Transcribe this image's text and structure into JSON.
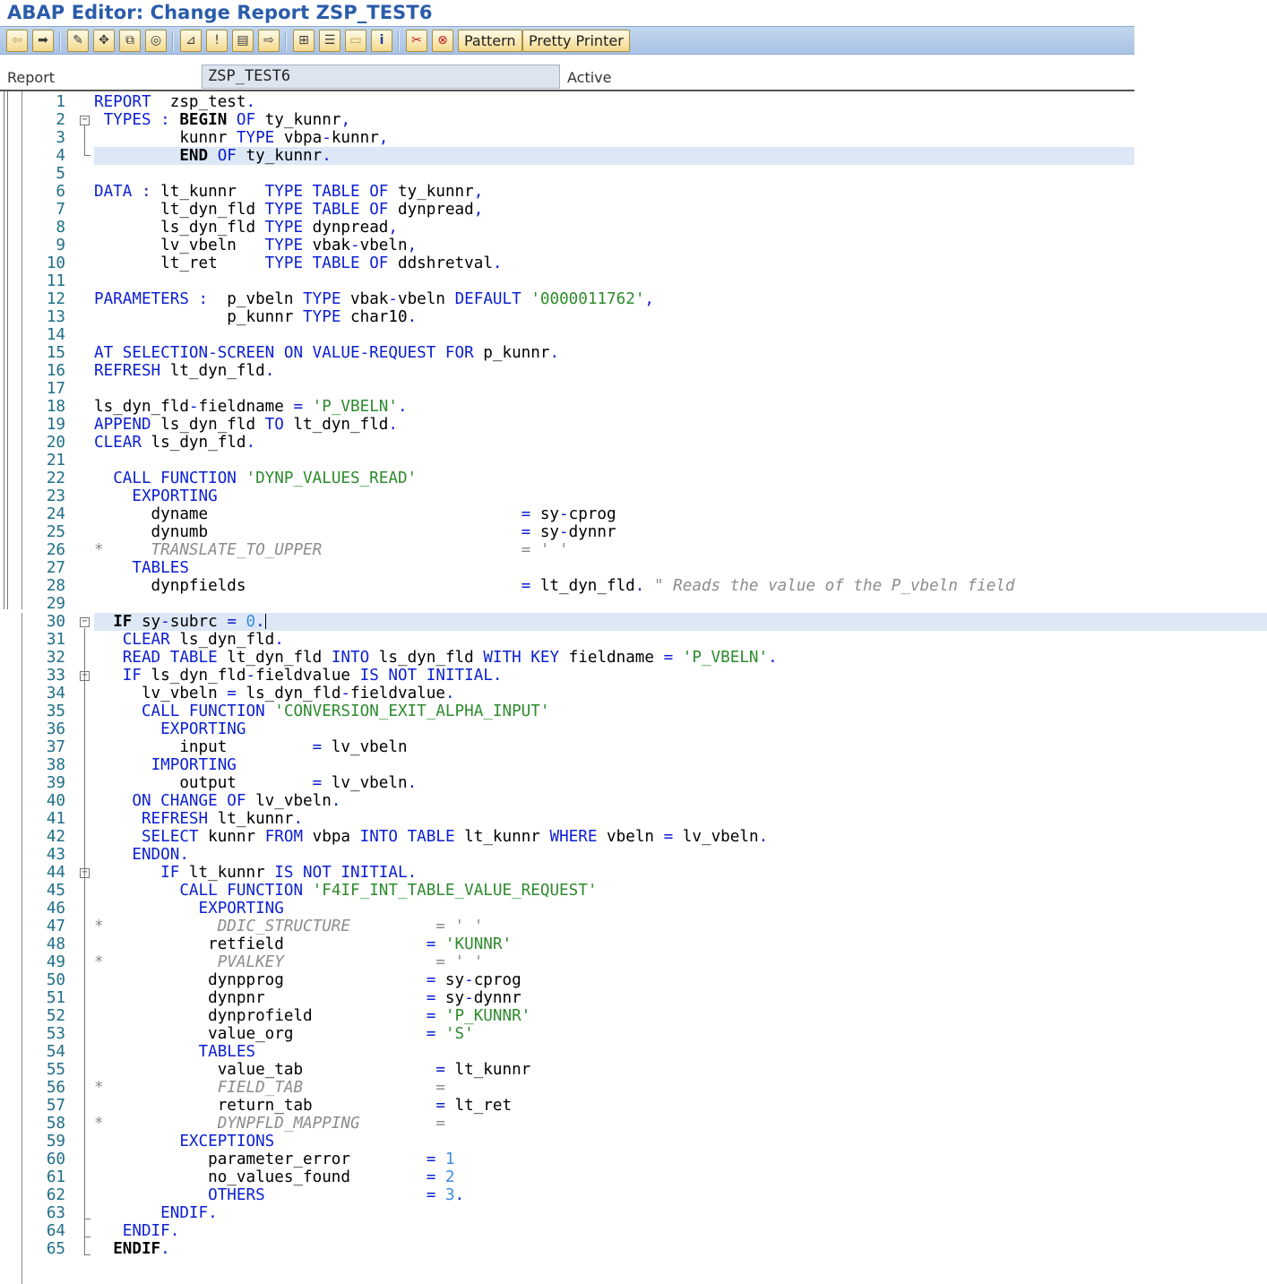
{
  "window": {
    "title": "ABAP Editor: Change Report ZSP_TEST6"
  },
  "toolbar": {
    "icons": [
      "back-icon",
      "forward-icon",
      "check-icon",
      "display-change-icon",
      "activate-icon",
      "test-icon",
      "where-used-icon",
      "set-breakpoint-icon",
      "stack-icon",
      "other-object-icon",
      "object-list-icon",
      "hierarchy-icon",
      "blank-icon",
      "info-icon",
      "cut-icon",
      "copy-icon"
    ],
    "pattern_label": "Pattern",
    "pretty_printer_label": "Pretty Printer"
  },
  "header": {
    "report_label": "Report",
    "report_value": "ZSP_TEST6",
    "status": "Active"
  },
  "editor": {
    "highlighted_lines": [
      4,
      30
    ],
    "cursor_line": 30,
    "lines": [
      [
        [
          "kw",
          "REPORT"
        ],
        [
          "t",
          "  zsp_test"
        ],
        [
          "kw",
          "."
        ]
      ],
      [
        [
          "t",
          " "
        ],
        [
          "kw",
          "TYPES"
        ],
        [
          "t",
          " "
        ],
        [
          "kw",
          ":"
        ],
        [
          "t",
          " "
        ],
        [
          "bk",
          "BEGIN"
        ],
        [
          "t",
          " "
        ],
        [
          "kw",
          "OF"
        ],
        [
          "t",
          " ty_kunnr"
        ],
        [
          "kw",
          ","
        ]
      ],
      [
        [
          "t",
          "         kunnr "
        ],
        [
          "kw",
          "TYPE"
        ],
        [
          "t",
          " vbpa"
        ],
        [
          "kw",
          "-"
        ],
        [
          "t",
          "kunnr"
        ],
        [
          "kw",
          ","
        ]
      ],
      [
        [
          "t",
          "         "
        ],
        [
          "bk",
          "END"
        ],
        [
          "t",
          " "
        ],
        [
          "kw",
          "OF"
        ],
        [
          "t",
          " ty_kunnr"
        ],
        [
          "kw",
          "."
        ]
      ],
      [],
      [
        [
          "kw",
          "DATA"
        ],
        [
          "t",
          " "
        ],
        [
          "kw",
          ":"
        ],
        [
          "t",
          " lt_kunnr   "
        ],
        [
          "kw",
          "TYPE"
        ],
        [
          "t",
          " "
        ],
        [
          "kw",
          "TABLE"
        ],
        [
          "t",
          " "
        ],
        [
          "kw",
          "OF"
        ],
        [
          "t",
          " ty_kunnr"
        ],
        [
          "kw",
          ","
        ]
      ],
      [
        [
          "t",
          "       lt_dyn_fld "
        ],
        [
          "kw",
          "TYPE"
        ],
        [
          "t",
          " "
        ],
        [
          "kw",
          "TABLE"
        ],
        [
          "t",
          " "
        ],
        [
          "kw",
          "OF"
        ],
        [
          "t",
          " dynpread"
        ],
        [
          "kw",
          ","
        ]
      ],
      [
        [
          "t",
          "       ls_dyn_fld "
        ],
        [
          "kw",
          "TYPE"
        ],
        [
          "t",
          " dynpread"
        ],
        [
          "kw",
          ","
        ]
      ],
      [
        [
          "t",
          "       lv_vbeln   "
        ],
        [
          "kw",
          "TYPE"
        ],
        [
          "t",
          " vbak"
        ],
        [
          "kw",
          "-"
        ],
        [
          "t",
          "vbeln"
        ],
        [
          "kw",
          ","
        ]
      ],
      [
        [
          "t",
          "       lt_ret     "
        ],
        [
          "kw",
          "TYPE"
        ],
        [
          "t",
          " "
        ],
        [
          "kw",
          "TABLE"
        ],
        [
          "t",
          " "
        ],
        [
          "kw",
          "OF"
        ],
        [
          "t",
          " ddshretval"
        ],
        [
          "kw",
          "."
        ]
      ],
      [],
      [
        [
          "kw",
          "PARAMETERS"
        ],
        [
          "t",
          " "
        ],
        [
          "kw",
          ":"
        ],
        [
          "t",
          "  p_vbeln "
        ],
        [
          "kw",
          "TYPE"
        ],
        [
          "t",
          " vbak"
        ],
        [
          "kw",
          "-"
        ],
        [
          "t",
          "vbeln "
        ],
        [
          "kw",
          "DEFAULT"
        ],
        [
          "t",
          " "
        ],
        [
          "str",
          "'0000011762'"
        ],
        [
          "kw",
          ","
        ]
      ],
      [
        [
          "t",
          "              p_kunnr "
        ],
        [
          "kw",
          "TYPE"
        ],
        [
          "t",
          " char10"
        ],
        [
          "kw",
          "."
        ]
      ],
      [],
      [
        [
          "kw",
          "AT SELECTION-SCREEN ON VALUE-REQUEST FOR"
        ],
        [
          "t",
          " p_kunnr"
        ],
        [
          "kw",
          "."
        ]
      ],
      [
        [
          "kw",
          "REFRESH"
        ],
        [
          "t",
          " lt_dyn_fld"
        ],
        [
          "kw",
          "."
        ]
      ],
      [],
      [
        [
          "t",
          "ls_dyn_fld"
        ],
        [
          "kw",
          "-"
        ],
        [
          "t",
          "fieldname "
        ],
        [
          "kw",
          "="
        ],
        [
          "t",
          " "
        ],
        [
          "str",
          "'P_VBELN'"
        ],
        [
          "kw",
          "."
        ]
      ],
      [
        [
          "kw",
          "APPEND"
        ],
        [
          "t",
          " ls_dyn_fld "
        ],
        [
          "kw",
          "TO"
        ],
        [
          "t",
          " lt_dyn_fld"
        ],
        [
          "kw",
          "."
        ]
      ],
      [
        [
          "kw",
          "CLEAR"
        ],
        [
          "t",
          " ls_dyn_fld"
        ],
        [
          "kw",
          "."
        ]
      ],
      [],
      [
        [
          "t",
          "  "
        ],
        [
          "kw",
          "CALL FUNCTION"
        ],
        [
          "t",
          " "
        ],
        [
          "str",
          "'DYNP_VALUES_READ'"
        ]
      ],
      [
        [
          "t",
          "    "
        ],
        [
          "kw",
          "EXPORTING"
        ]
      ],
      [
        [
          "t",
          "      dyname                                 "
        ],
        [
          "kw",
          "="
        ],
        [
          "t",
          " sy"
        ],
        [
          "kw",
          "-"
        ],
        [
          "t",
          "cprog"
        ]
      ],
      [
        [
          "t",
          "      dynumb                                 "
        ],
        [
          "kw",
          "="
        ],
        [
          "t",
          " sy"
        ],
        [
          "kw",
          "-"
        ],
        [
          "t",
          "dynnr"
        ]
      ],
      [
        [
          "cmt",
          "*     TRANSLATE_TO_UPPER                     = ' '"
        ]
      ],
      [
        [
          "t",
          "    "
        ],
        [
          "kw",
          "TABLES"
        ]
      ],
      [
        [
          "t",
          "      dynpfields                             "
        ],
        [
          "kw",
          "="
        ],
        [
          "t",
          " lt_dyn_fld"
        ],
        [
          "kw",
          "."
        ],
        [
          "t",
          " "
        ],
        [
          "cmt",
          "\" Reads the value of the P_vbeln field"
        ]
      ],
      [],
      [
        [
          "t",
          "  "
        ],
        [
          "bk",
          "IF"
        ],
        [
          "t",
          " sy"
        ],
        [
          "kw",
          "-"
        ],
        [
          "t",
          "subrc "
        ],
        [
          "kw",
          "="
        ],
        [
          "t",
          " "
        ],
        [
          "num",
          "0"
        ],
        [
          "kw",
          "."
        ]
      ],
      [
        [
          "t",
          "   "
        ],
        [
          "kw",
          "CLEAR"
        ],
        [
          "t",
          " ls_dyn_fld"
        ],
        [
          "kw",
          "."
        ]
      ],
      [
        [
          "t",
          "   "
        ],
        [
          "kw",
          "READ TABLE"
        ],
        [
          "t",
          " lt_dyn_fld "
        ],
        [
          "kw",
          "INTO"
        ],
        [
          "t",
          " ls_dyn_fld "
        ],
        [
          "kw",
          "WITH KEY"
        ],
        [
          "t",
          " fieldname "
        ],
        [
          "kw",
          "="
        ],
        [
          "t",
          " "
        ],
        [
          "str",
          "'P_VBELN'"
        ],
        [
          "kw",
          "."
        ]
      ],
      [
        [
          "t",
          "   "
        ],
        [
          "kw",
          "IF"
        ],
        [
          "t",
          " ls_dyn_fld"
        ],
        [
          "kw",
          "-"
        ],
        [
          "t",
          "fieldvalue "
        ],
        [
          "kw",
          "IS NOT INITIAL"
        ],
        [
          "kw",
          "."
        ]
      ],
      [
        [
          "t",
          "     lv_vbeln "
        ],
        [
          "kw",
          "="
        ],
        [
          "t",
          " ls_dyn_fld"
        ],
        [
          "kw",
          "-"
        ],
        [
          "t",
          "fieldvalue"
        ],
        [
          "kw",
          "."
        ]
      ],
      [
        [
          "t",
          "     "
        ],
        [
          "kw",
          "CALL FUNCTION"
        ],
        [
          "t",
          " "
        ],
        [
          "str",
          "'CONVERSION_EXIT_ALPHA_INPUT'"
        ]
      ],
      [
        [
          "t",
          "       "
        ],
        [
          "kw",
          "EXPORTING"
        ]
      ],
      [
        [
          "t",
          "         input         "
        ],
        [
          "kw",
          "="
        ],
        [
          "t",
          " lv_vbeln"
        ]
      ],
      [
        [
          "t",
          "      "
        ],
        [
          "kw",
          "IMPORTING"
        ]
      ],
      [
        [
          "t",
          "         output        "
        ],
        [
          "kw",
          "="
        ],
        [
          "t",
          " lv_vbeln"
        ],
        [
          "kw",
          "."
        ]
      ],
      [
        [
          "t",
          "    "
        ],
        [
          "kw",
          "ON CHANGE OF"
        ],
        [
          "t",
          " lv_vbeln"
        ],
        [
          "kw",
          "."
        ]
      ],
      [
        [
          "t",
          "     "
        ],
        [
          "kw",
          "REFRESH"
        ],
        [
          "t",
          " lt_kunnr"
        ],
        [
          "kw",
          "."
        ]
      ],
      [
        [
          "t",
          "     "
        ],
        [
          "kw",
          "SELECT"
        ],
        [
          "t",
          " kunnr "
        ],
        [
          "kw",
          "FROM"
        ],
        [
          "t",
          " vbpa "
        ],
        [
          "kw",
          "INTO TABLE"
        ],
        [
          "t",
          " lt_kunnr "
        ],
        [
          "kw",
          "WHERE"
        ],
        [
          "t",
          " vbeln "
        ],
        [
          "kw",
          "="
        ],
        [
          "t",
          " lv_vbeln"
        ],
        [
          "kw",
          "."
        ]
      ],
      [
        [
          "t",
          "    "
        ],
        [
          "kw",
          "ENDON"
        ],
        [
          "kw",
          "."
        ]
      ],
      [
        [
          "t",
          "       "
        ],
        [
          "kw",
          "IF"
        ],
        [
          "t",
          " lt_kunnr "
        ],
        [
          "kw",
          "IS NOT INITIAL"
        ],
        [
          "kw",
          "."
        ]
      ],
      [
        [
          "t",
          "         "
        ],
        [
          "kw",
          "CALL FUNCTION"
        ],
        [
          "t",
          " "
        ],
        [
          "str",
          "'F4IF_INT_TABLE_VALUE_REQUEST'"
        ]
      ],
      [
        [
          "t",
          "           "
        ],
        [
          "kw",
          "EXPORTING"
        ]
      ],
      [
        [
          "cmt",
          "*            DDIC_STRUCTURE         = ' '"
        ]
      ],
      [
        [
          "t",
          "            retfield               "
        ],
        [
          "kw",
          "="
        ],
        [
          "t",
          " "
        ],
        [
          "str",
          "'KUNNR'"
        ]
      ],
      [
        [
          "cmt",
          "*            PVALKEY                = ' '"
        ]
      ],
      [
        [
          "t",
          "            dynpprog               "
        ],
        [
          "kw",
          "="
        ],
        [
          "t",
          " sy"
        ],
        [
          "kw",
          "-"
        ],
        [
          "t",
          "cprog"
        ]
      ],
      [
        [
          "t",
          "            dynpnr                 "
        ],
        [
          "kw",
          "="
        ],
        [
          "t",
          " sy"
        ],
        [
          "kw",
          "-"
        ],
        [
          "t",
          "dynnr"
        ]
      ],
      [
        [
          "t",
          "            dynprofield            "
        ],
        [
          "kw",
          "="
        ],
        [
          "t",
          " "
        ],
        [
          "str",
          "'P_KUNNR'"
        ]
      ],
      [
        [
          "t",
          "            value_org              "
        ],
        [
          "kw",
          "="
        ],
        [
          "t",
          " "
        ],
        [
          "str",
          "'S'"
        ]
      ],
      [
        [
          "t",
          "           "
        ],
        [
          "kw",
          "TABLES"
        ]
      ],
      [
        [
          "t",
          "             value_tab              "
        ],
        [
          "kw",
          "="
        ],
        [
          "t",
          " lt_kunnr"
        ]
      ],
      [
        [
          "cmt",
          "*            FIELD_TAB              ="
        ]
      ],
      [
        [
          "t",
          "             return_tab             "
        ],
        [
          "kw",
          "="
        ],
        [
          "t",
          " lt_ret"
        ]
      ],
      [
        [
          "cmt",
          "*            DYNPFLD_MAPPING        ="
        ]
      ],
      [
        [
          "t",
          "         "
        ],
        [
          "kw",
          "EXCEPTIONS"
        ]
      ],
      [
        [
          "t",
          "            parameter_error        "
        ],
        [
          "kw",
          "="
        ],
        [
          "t",
          " "
        ],
        [
          "num",
          "1"
        ]
      ],
      [
        [
          "t",
          "            no_values_found        "
        ],
        [
          "kw",
          "="
        ],
        [
          "t",
          " "
        ],
        [
          "num",
          "2"
        ]
      ],
      [
        [
          "t",
          "            "
        ],
        [
          "kw",
          "OTHERS"
        ],
        [
          "t",
          "                 "
        ],
        [
          "kw",
          "="
        ],
        [
          "t",
          " "
        ],
        [
          "num",
          "3"
        ],
        [
          "kw",
          "."
        ]
      ],
      [
        [
          "t",
          "       "
        ],
        [
          "kw",
          "ENDIF"
        ],
        [
          "kw",
          "."
        ]
      ],
      [
        [
          "t",
          "   "
        ],
        [
          "kw",
          "ENDIF"
        ],
        [
          "kw",
          "."
        ]
      ],
      [
        [
          "t",
          "  "
        ],
        [
          "bk",
          "ENDIF"
        ],
        [
          "kw",
          "."
        ]
      ]
    ]
  }
}
